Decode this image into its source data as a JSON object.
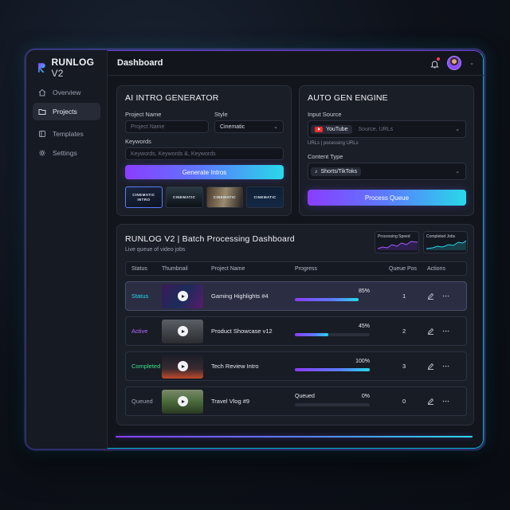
{
  "app": {
    "name": "RUNLOG",
    "version": "V2"
  },
  "sidebar": {
    "items": [
      {
        "label": "Overview",
        "icon": "home-icon"
      },
      {
        "label": "Projects",
        "icon": "folder-icon",
        "active": true
      },
      {
        "label": "Templates",
        "icon": "template-icon"
      },
      {
        "label": "Settings",
        "icon": "gear-icon"
      }
    ]
  },
  "header": {
    "title": "Dashboard"
  },
  "intro_generator": {
    "title": "AI INTRO GENERATOR",
    "project_name_label": "Project Name",
    "project_name_placeholder": "Project Name",
    "style_label": "Style",
    "style_value": "Cinematic",
    "keywords_label": "Keywords",
    "keywords_placeholder": "Keywords, Keywords &, Keywords",
    "generate_button": "Generate Intros",
    "thumbnails": [
      "CINEMATIC INTRO",
      "CINEMATIC",
      "CINEMATIC",
      "CINEMATIC"
    ]
  },
  "auto_gen": {
    "title": "AUTO GEN ENGINE",
    "input_source_label": "Input Source",
    "source_chip": "YouTube",
    "source_placeholder": "Source, URLs",
    "source_hint": "URLs | pocessing URLs",
    "content_type_label": "Content Type",
    "content_type_value": "Shorts/TikToks",
    "process_button": "Process Queue"
  },
  "batch": {
    "title": "RUNLOG V2 | Batch Processing Dashboard",
    "subtitle": "Live queue of video jobs",
    "mini_charts": [
      {
        "label": "Processing Speed",
        "color": "#8a3dff"
      },
      {
        "label": "Completed Jobs",
        "color": "#27d9e8"
      }
    ],
    "columns": [
      "Status",
      "Thumbnail",
      "Project Name",
      "Progress",
      "Queue Pos",
      "Actions"
    ],
    "rows": [
      {
        "status": "Status",
        "status_color": "#27d9e8",
        "name": "Gaming Highlights #4",
        "progress": 85,
        "progress_text": "85%",
        "progress_label": "",
        "queue_pos": "1",
        "highlight": true
      },
      {
        "status": "Active",
        "status_color": "#b46bff",
        "name": "Product Showcase v12",
        "progress": 45,
        "progress_text": "45%",
        "progress_label": "",
        "queue_pos": "2",
        "highlight": false
      },
      {
        "status": "Completed",
        "status_color": "#3ee08a",
        "name": "Tech Review Intro",
        "progress": 100,
        "progress_text": "100%",
        "progress_label": "",
        "queue_pos": "3",
        "highlight": false
      },
      {
        "status": "Queued",
        "status_color": "#9aa1b2",
        "name": "Travel Vlog #9",
        "progress": 0,
        "progress_text": "0%",
        "progress_label": "Queued",
        "queue_pos": "0",
        "highlight": false
      }
    ]
  }
}
